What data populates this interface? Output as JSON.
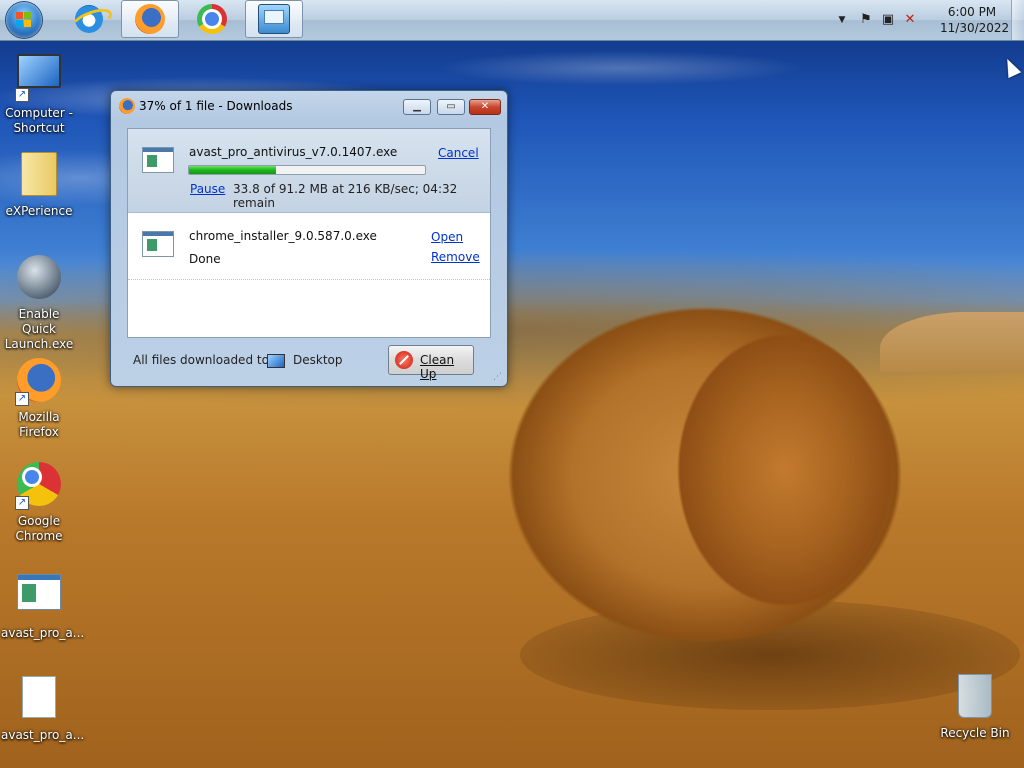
{
  "taskbar": {
    "start": {
      "icon": "windows-start-icon"
    },
    "pinned": [
      {
        "name": "Internet Explorer",
        "icon": "internet-explorer-icon"
      },
      {
        "name": "Mozilla Firefox",
        "icon": "firefox-icon",
        "active": true
      },
      {
        "name": "Google Chrome",
        "icon": "chrome-icon"
      },
      {
        "name": "Control Panel",
        "icon": "control-panel-icon"
      }
    ],
    "tray": {
      "icons": [
        "show-hidden-icons-arrow",
        "action-center-flag-icon",
        "network-icon",
        "volume-muted-icon"
      ],
      "time": "6:00 PM",
      "date": "11/30/2022"
    }
  },
  "desktop": {
    "icons": [
      {
        "label": "Computer - Shortcut",
        "icon": "computer-icon"
      },
      {
        "label": "eXPerience",
        "icon": "folder-icon"
      },
      {
        "label": "Enable Quick Launch.exe",
        "icon": "quick-launch-icon"
      },
      {
        "label": "Mozilla Firefox",
        "icon": "firefox-icon"
      },
      {
        "label": "Google Chrome",
        "icon": "chrome-icon"
      },
      {
        "label": "avast_pro_a...",
        "icon": "exe-file-icon"
      },
      {
        "label": "avast_pro_a...",
        "icon": "blank-file-icon"
      },
      {
        "label": "Recycle Bin",
        "icon": "recycle-bin-icon"
      }
    ]
  },
  "downloads_window": {
    "title": "37% of 1 file - Downloads",
    "caption_buttons": {
      "minimize": "minimize-icon",
      "maximize": "maximize-icon",
      "close": "close-icon"
    },
    "items": [
      {
        "filename": "avast_pro_antivirus_v7.0.1407.exe",
        "action": "Cancel",
        "secondary_action": "Pause",
        "status": "33.8 of 91.2 MB at 216 KB/sec; 04:32 remain",
        "progress_percent": 37
      },
      {
        "filename": "chrome_installer_9.0.587.0.exe",
        "status": "Done",
        "action": "Open",
        "secondary_action": "Remove"
      }
    ],
    "footer": {
      "label": "All files downloaded to:",
      "destination": "Desktop",
      "cleanup_label": "Clean Up"
    }
  },
  "colors": {
    "progress_fill": "#1fb51c",
    "link": "#0033cc",
    "title_close": "#c7462e"
  }
}
